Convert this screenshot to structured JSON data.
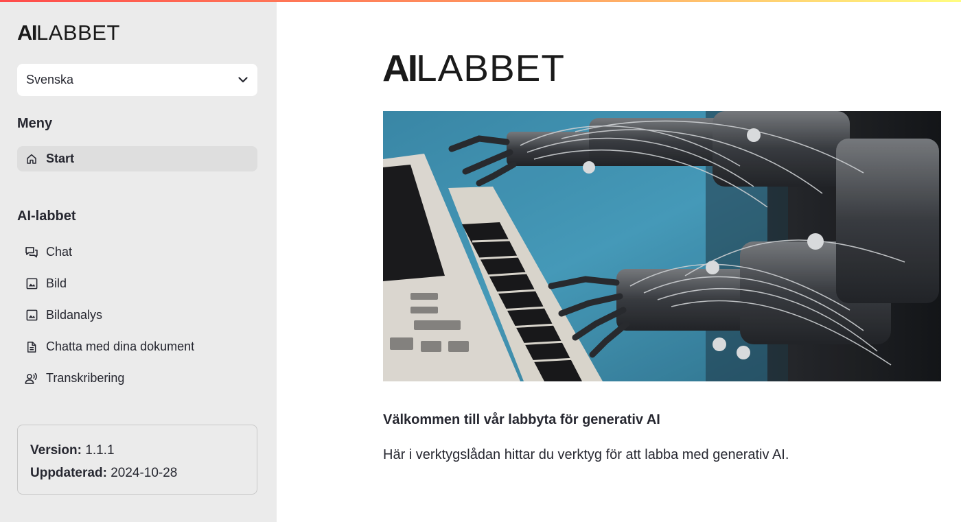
{
  "app": {
    "logo_bold": "AI",
    "logo_light": "LABBET"
  },
  "sidebar": {
    "language": {
      "selected": "Svenska"
    },
    "menu_heading": "Meny",
    "menu_items": [
      {
        "label": "Start",
        "icon": "home-icon",
        "active": true
      }
    ],
    "tools_heading": "AI-labbet",
    "tool_items": [
      {
        "label": "Chat",
        "icon": "chat-icon"
      },
      {
        "label": "Bild",
        "icon": "image-icon"
      },
      {
        "label": "Bildanalys",
        "icon": "image-icon"
      },
      {
        "label": "Chatta med dina dokument",
        "icon": "document-icon"
      },
      {
        "label": "Transkribering",
        "icon": "voice-icon"
      }
    ],
    "info": {
      "version_label": "Version:",
      "version_value": "1.1.1",
      "updated_label": "Uppdaterad:",
      "updated_value": "2024-10-28"
    }
  },
  "main": {
    "logo_bold": "AI",
    "logo_light": "LABBET",
    "hero_image": "robot-hands-playing-keyboard",
    "welcome_heading": "Välkommen till vår labbyta för generativ AI",
    "intro_text": "Här i verktygslådan hittar du verktyg för att labba med generativ AI."
  },
  "colors": {
    "sidebar_bg": "#ebebeb",
    "active_item_bg": "#dedede",
    "text": "#262730",
    "accent_gradient_start": "#ff4b4b",
    "accent_gradient_end": "#fffd80"
  }
}
